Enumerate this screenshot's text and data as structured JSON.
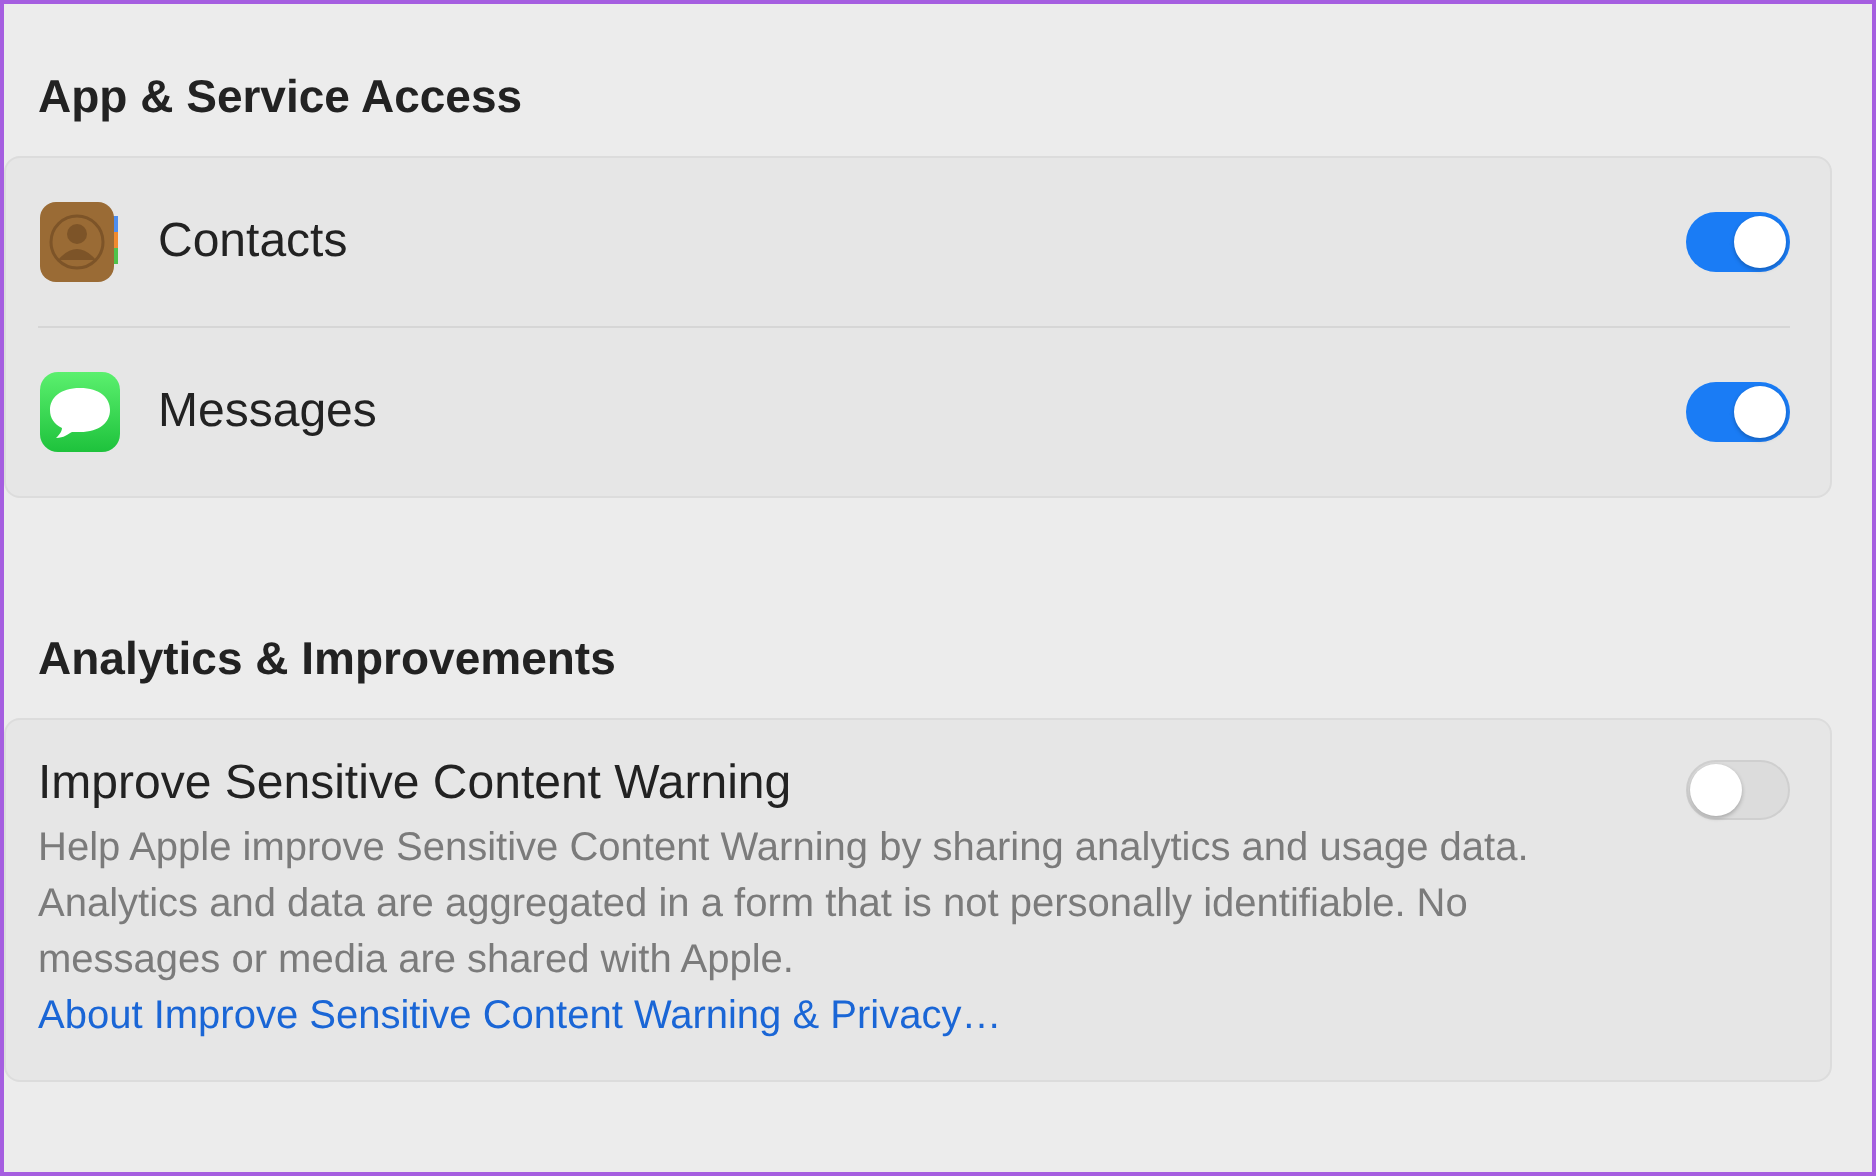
{
  "sections": [
    {
      "title": "App & Service Access",
      "items": [
        {
          "kind": "app",
          "label": "Contacts",
          "on": true
        },
        {
          "kind": "app",
          "label": "Messages",
          "on": true
        }
      ]
    },
    {
      "title": "Analytics & Improvements",
      "items": [
        {
          "kind": "detail",
          "label": "Improve Sensitive Content Warning",
          "description": "Help Apple improve Sensitive Content Warning by sharing analytics and usage data. Analytics and data are aggregated in a form that is not personally identifiable. No messages or media are shared with Apple.",
          "link": "About Improve Sensitive Content Warning & Privacy…",
          "on": false
        }
      ]
    }
  ]
}
